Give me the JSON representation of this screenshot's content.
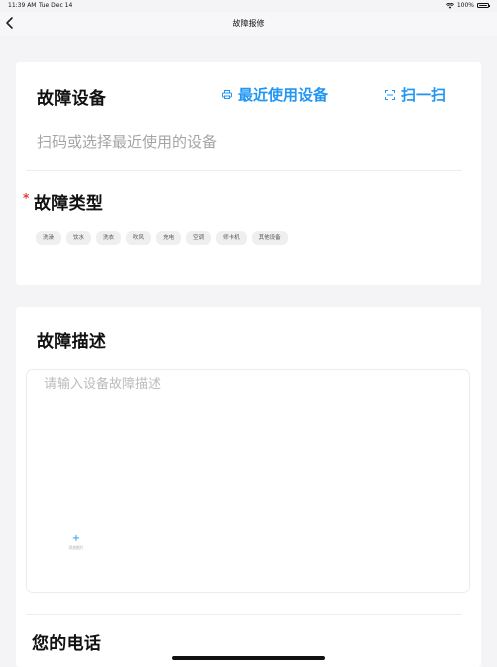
{
  "status_bar": {
    "time": "11:39 AM",
    "date": "Tue Dec 14",
    "battery": "100%"
  },
  "nav": {
    "title": "故障报修"
  },
  "device": {
    "title": "故障设备",
    "recent_label": "最近使用设备",
    "scan_label": "扫一扫",
    "placeholder": "扫码或选择最近使用的设备"
  },
  "fault_type": {
    "required_mark": "*",
    "title": "故障类型",
    "chips": [
      "洗澡",
      "饮水",
      "洗衣",
      "吹风",
      "充电",
      "空调",
      "师卡机",
      "其他设备"
    ]
  },
  "description": {
    "title": "故障描述",
    "placeholder": "请输入设备故障描述",
    "add_image_label": "添加图片"
  },
  "phone": {
    "title": "您的电话"
  },
  "colors": {
    "accent": "#2196f3",
    "required": "#e53935",
    "background": "#f4f4f6"
  }
}
